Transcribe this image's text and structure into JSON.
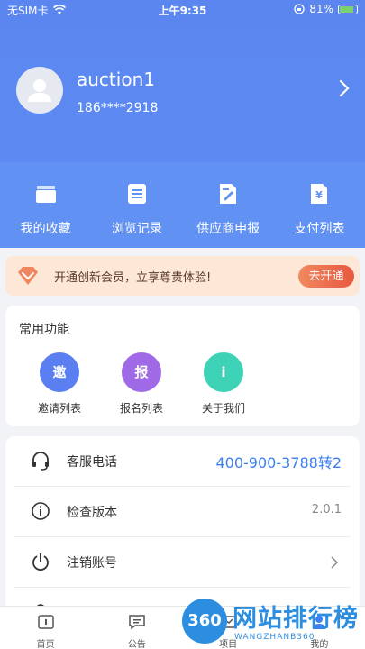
{
  "status_bar": {
    "carrier": "无SIM卡",
    "time": "上午9:35",
    "battery": "81%"
  },
  "profile": {
    "name": "auction1",
    "phone": "186****2918"
  },
  "quick_actions": [
    {
      "label": "我的收藏",
      "icon": "folder-icon"
    },
    {
      "label": "浏览记录",
      "icon": "list-icon"
    },
    {
      "label": "供应商申报",
      "icon": "edit-document-icon"
    },
    {
      "label": "支付列表",
      "icon": "payment-document-icon"
    }
  ],
  "vip_banner": {
    "text": "开通创新会员，立享尊贵体验!",
    "button": "去开通"
  },
  "common_functions": {
    "title": "常用功能",
    "items": [
      {
        "label": "邀请列表",
        "glyph": "邀",
        "color": "#5b7ff0"
      },
      {
        "label": "报名列表",
        "glyph": "报",
        "color": "#a06ae6"
      },
      {
        "label": "关于我们",
        "glyph": "i",
        "color": "#3ed2b6"
      }
    ]
  },
  "settings": {
    "hotline_label": "客服电话",
    "hotline_value": "400-900-3788转2",
    "version_label": "检查版本",
    "version_value": "2.0.1",
    "cancel_label": "注销账号"
  },
  "tabbar": [
    {
      "label": "首页",
      "icon": "home-icon"
    },
    {
      "label": "公告",
      "icon": "notice-icon"
    },
    {
      "label": "项目",
      "icon": "project-icon"
    },
    {
      "label": "我的",
      "icon": "user-icon"
    }
  ],
  "watermark": {
    "logo": "360",
    "text": "网站排行榜",
    "sub": "WANGZHANB360"
  }
}
